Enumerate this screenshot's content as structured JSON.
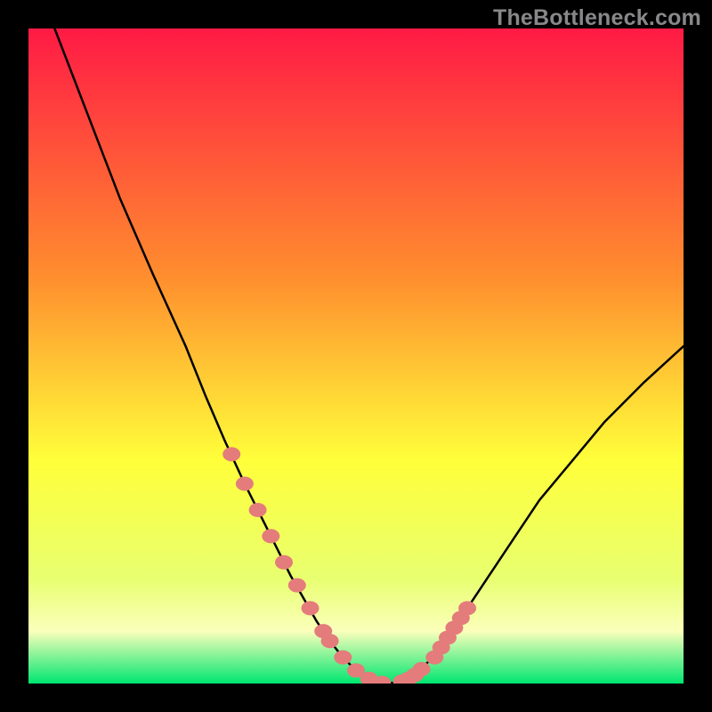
{
  "watermark": "TheBottleneck.com",
  "colors": {
    "frame": "#000000",
    "curve": "#000000",
    "markers": "#e47c7b",
    "grad_top": "#ff1a45",
    "grad_mid1": "#ff8e2e",
    "grad_mid2": "#ffff3a",
    "grad_mid3": "#e8ff70",
    "grad_mid4": "#fbffbb",
    "grad_bot": "#00e670"
  },
  "chart_data": {
    "type": "line",
    "title": "",
    "xlabel": "",
    "ylabel": "",
    "xlim": [
      0,
      100
    ],
    "ylim": [
      0,
      100
    ],
    "x": [
      4,
      9,
      14,
      19,
      24,
      27,
      30,
      33,
      36,
      38,
      40,
      42,
      44,
      46,
      48,
      50,
      52,
      54,
      56,
      58,
      60,
      63,
      66,
      70,
      74,
      78,
      83,
      88,
      94,
      100
    ],
    "y": [
      100,
      87,
      74,
      62.5,
      51.5,
      44,
      37,
      30.5,
      24.5,
      20.5,
      16.5,
      13,
      9.5,
      6.5,
      4,
      2,
      0.7,
      0.1,
      0.1,
      0.7,
      2.2,
      5.5,
      10,
      16,
      22,
      28,
      34,
      40,
      46,
      51.5
    ],
    "markers": {
      "x": [
        31,
        33,
        35,
        37,
        39,
        41,
        43,
        45,
        46,
        48,
        50,
        52,
        54,
        57,
        58,
        59,
        60,
        62,
        63,
        64,
        65,
        66,
        67
      ],
      "y": [
        35,
        30.5,
        26.5,
        22.5,
        18.5,
        15,
        11.5,
        8,
        6.5,
        4,
        2,
        0.7,
        0.1,
        0.3,
        0.7,
        1.3,
        2.2,
        4,
        5.5,
        7,
        8.5,
        10,
        11.5
      ]
    }
  }
}
